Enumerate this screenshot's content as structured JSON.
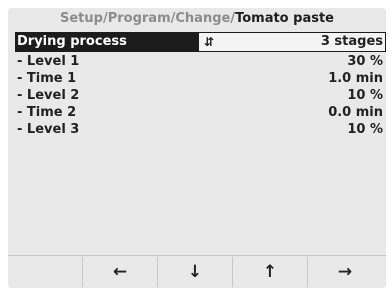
{
  "breadcrumb": {
    "part1": "Setup",
    "part2": "Program",
    "part3": "Change",
    "current": "Tomato paste",
    "separator": "/"
  },
  "selected": {
    "label": "Drying process",
    "value": "3 stages",
    "icon": "updown-arrows-icon",
    "icon_glyph": "⇵"
  },
  "rows": [
    {
      "label": "- Level 1",
      "value": "30 %"
    },
    {
      "label": "- Time 1",
      "value": "1.0 min"
    },
    {
      "label": "- Level 2",
      "value": "10 %"
    },
    {
      "label": "- Time 2",
      "value": "0.0 min"
    },
    {
      "label": "- Level 3",
      "value": "10 %"
    }
  ],
  "softkeys": [
    {
      "name": "softkey-blank",
      "glyph": ""
    },
    {
      "name": "left-arrow-icon",
      "glyph": "←"
    },
    {
      "name": "down-arrow-icon",
      "glyph": "↓"
    },
    {
      "name": "up-arrow-icon",
      "glyph": "↑"
    },
    {
      "name": "right-arrow-icon",
      "glyph": "→"
    }
  ],
  "colors": {
    "screen_bg": "#e9e9e9",
    "selection_bg": "#1c1c1c",
    "breadcrumb_dim": "#8c8c8c",
    "text": "#222222"
  }
}
